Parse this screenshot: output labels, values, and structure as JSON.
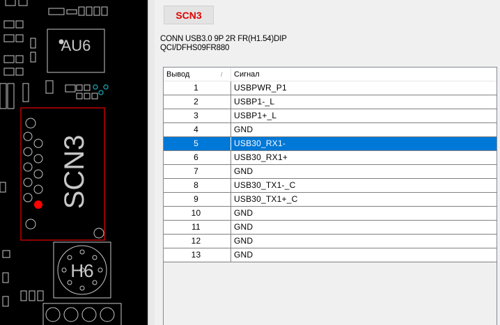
{
  "pcb": {
    "labels": {
      "au6": "AU6",
      "scn3": "SCN3",
      "h6": "H6"
    },
    "colors": {
      "background": "#000000",
      "silkscreen": "#c8c8c8",
      "highlight_outline": "#c00000",
      "pin1_marker": "#ff0000"
    }
  },
  "component": {
    "ref": "SCN3",
    "description": "CONN USB3.0 9P 2R FR(H1.54)DIP",
    "manufacturer_part": "QCI/DFHS09FR880",
    "ref_color": "#e00000"
  },
  "table": {
    "headers": {
      "pin": "Вывод",
      "signal": "Сигнал",
      "sort_glyph": "/"
    },
    "selected_color": "#0078d7",
    "rows": [
      {
        "pin": "1",
        "signal": "USBPWR_P1"
      },
      {
        "pin": "2",
        "signal": "USBP1-_L"
      },
      {
        "pin": "3",
        "signal": "USBP1+_L"
      },
      {
        "pin": "4",
        "signal": "GND"
      },
      {
        "pin": "5",
        "signal": "USB30_RX1-",
        "selected": true
      },
      {
        "pin": "6",
        "signal": "USB30_RX1+"
      },
      {
        "pin": "7",
        "signal": "GND"
      },
      {
        "pin": "8",
        "signal": "USB30_TX1-_C"
      },
      {
        "pin": "9",
        "signal": "USB30_TX1+_C"
      },
      {
        "pin": "10",
        "signal": "GND"
      },
      {
        "pin": "11",
        "signal": "GND"
      },
      {
        "pin": "12",
        "signal": "GND"
      },
      {
        "pin": "13",
        "signal": "GND"
      }
    ]
  }
}
